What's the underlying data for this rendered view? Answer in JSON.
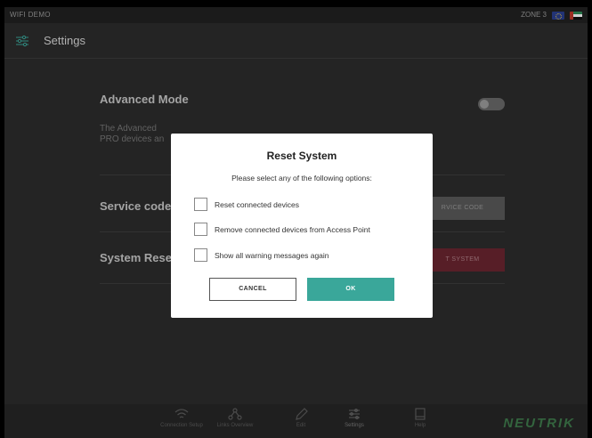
{
  "status": {
    "left_text": "WIFI DEMO",
    "zone": "ZONE 3"
  },
  "header": {
    "title": "Settings"
  },
  "settings": {
    "advanced_mode": {
      "title": "Advanced Mode",
      "desc_line1": "The Advanced",
      "desc_line2": "PRO devices an"
    },
    "service_code": {
      "title": "Service code",
      "button": "RVICE CODE"
    },
    "system_reset": {
      "title": "System Rese",
      "button": "T SYSTEM"
    }
  },
  "nav": {
    "items": [
      {
        "label": "Connection Setup"
      },
      {
        "label": "Links Overview"
      },
      {
        "label": "Edit"
      },
      {
        "label": "Settings"
      },
      {
        "label": "Help"
      }
    ],
    "logo": "NEUTRIK"
  },
  "dialog": {
    "title": "Reset System",
    "subtitle": "Please select any of the following options:",
    "options": [
      {
        "label": "Reset connected devices"
      },
      {
        "label": "Remove connected devices from Access Point"
      },
      {
        "label": "Show all warning messages again"
      }
    ],
    "cancel_label": "CANCEL",
    "ok_label": "OK"
  },
  "colors": {
    "accent": "#3aa79a",
    "danger": "#6b2530",
    "brand": "#3f7a4c"
  }
}
